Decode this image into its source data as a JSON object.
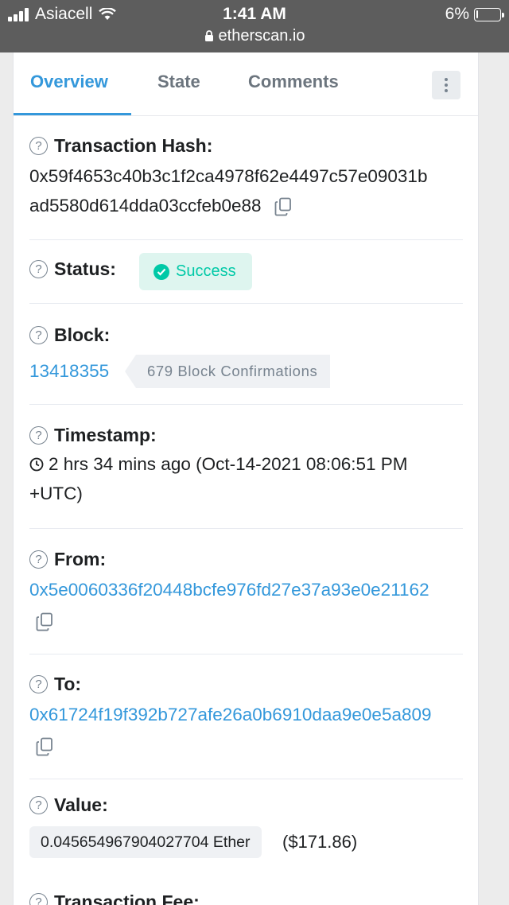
{
  "status_bar": {
    "carrier": "Asiacell",
    "time": "1:41 AM",
    "url": "etherscan.io",
    "battery": "6%",
    "battery_level": 0.06
  },
  "tabs": [
    {
      "label": "Overview",
      "active": true
    },
    {
      "label": "State",
      "active": false
    },
    {
      "label": "Comments",
      "active": false
    }
  ],
  "tx": {
    "hash_label": "Transaction Hash:",
    "hash_line1": "0x59f4653c40b3c1f2ca4978f62e4497c57e09031b",
    "hash_line2": "ad5580d614dda03ccfeb0e88",
    "status_label": "Status:",
    "status_value": "Success",
    "block_label": "Block:",
    "block_number": "13418355",
    "block_confirmations": "679 Block Confirmations",
    "timestamp_label": "Timestamp:",
    "timestamp_line1": "2 hrs 34 mins ago (Oct-14-2021 08:06:51 PM",
    "timestamp_line2": "+UTC)",
    "from_label": "From:",
    "from_address": "0x5e0060336f20448bcfe976fd27e37a93e0e21162",
    "to_label": "To:",
    "to_address": "0x61724f19f392b727afe26a0b6910daa9e0e5a809",
    "value_label": "Value:",
    "value_ether": "0.045654967904027704 Ether",
    "value_usd": "($171.86)",
    "fee_label": "Transaction Fee:"
  },
  "colors": {
    "accent": "#3498db",
    "success": "#00c9a7",
    "status_bar": "#5d5d5d"
  },
  "icons": [
    "signal-icon",
    "wifi-icon",
    "lock-icon",
    "battery-icon",
    "more-vertical-icon",
    "question-icon",
    "copy-icon",
    "check-circle-icon",
    "clock-icon"
  ]
}
